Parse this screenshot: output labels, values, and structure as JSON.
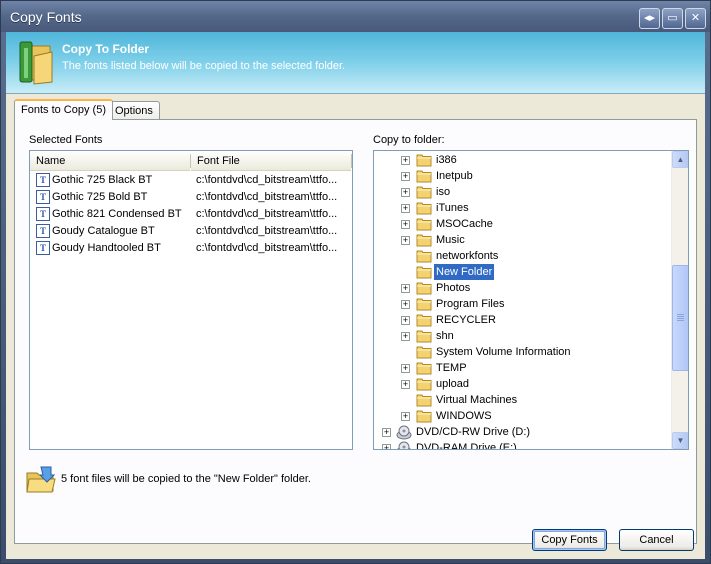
{
  "window": {
    "title": "Copy Fonts"
  },
  "titlebar_buttons": {
    "restore": "◂▸",
    "maximize": "▭",
    "close": "✕"
  },
  "header": {
    "title": "Copy To Folder",
    "subtitle": "The fonts listed below will be copied to the selected folder."
  },
  "tabs": [
    {
      "label": "Fonts to Copy (5)",
      "active": true
    },
    {
      "label": "Options",
      "active": false
    }
  ],
  "selected_fonts": {
    "label": "Selected Fonts",
    "columns": [
      "Name",
      "Font File"
    ],
    "rows": [
      {
        "name": "Gothic 725 Black BT",
        "file": "c:\\fontdvd\\cd_bitstream\\ttfo..."
      },
      {
        "name": "Gothic 725 Bold BT",
        "file": "c:\\fontdvd\\cd_bitstream\\ttfo..."
      },
      {
        "name": "Gothic 821 Condensed BT",
        "file": "c:\\fontdvd\\cd_bitstream\\ttfo..."
      },
      {
        "name": "Goudy Catalogue BT",
        "file": "c:\\fontdvd\\cd_bitstream\\ttfo..."
      },
      {
        "name": "Goudy Handtooled BT",
        "file": "c:\\fontdvd\\cd_bitstream\\ttfo..."
      }
    ]
  },
  "copy_to": {
    "label": "Copy to folder:",
    "nodes": [
      {
        "label": "i386",
        "expandable": true,
        "selected": false
      },
      {
        "label": "Inetpub",
        "expandable": true,
        "selected": false
      },
      {
        "label": "iso",
        "expandable": true,
        "selected": false
      },
      {
        "label": "iTunes",
        "expandable": true,
        "selected": false
      },
      {
        "label": "MSOCache",
        "expandable": true,
        "selected": false
      },
      {
        "label": "Music",
        "expandable": true,
        "selected": false
      },
      {
        "label": "networkfonts",
        "expandable": false,
        "selected": false
      },
      {
        "label": "New Folder",
        "expandable": false,
        "selected": true
      },
      {
        "label": "Photos",
        "expandable": true,
        "selected": false
      },
      {
        "label": "Program Files",
        "expandable": true,
        "selected": false
      },
      {
        "label": "RECYCLER",
        "expandable": true,
        "selected": false
      },
      {
        "label": "shn",
        "expandable": true,
        "selected": false
      },
      {
        "label": "System Volume Information",
        "expandable": false,
        "selected": false
      },
      {
        "label": "TEMP",
        "expandable": true,
        "selected": false
      },
      {
        "label": "upload",
        "expandable": true,
        "selected": false
      },
      {
        "label": "Virtual Machines",
        "expandable": false,
        "selected": false
      },
      {
        "label": "WINDOWS",
        "expandable": true,
        "selected": false
      }
    ],
    "drives": [
      {
        "label": "DVD/CD-RW Drive (D:)"
      },
      {
        "label": "DVD-RAM Drive (E:)"
      }
    ]
  },
  "info_message": "5 font files will be copied to the \"New Folder\" folder.",
  "buttons": {
    "ok": "Copy Fonts",
    "cancel": "Cancel"
  },
  "colors": {
    "selection": "#316ac5",
    "header_gradient_top": "#4fb6da",
    "tab_active_accent": "#f7b64a"
  }
}
